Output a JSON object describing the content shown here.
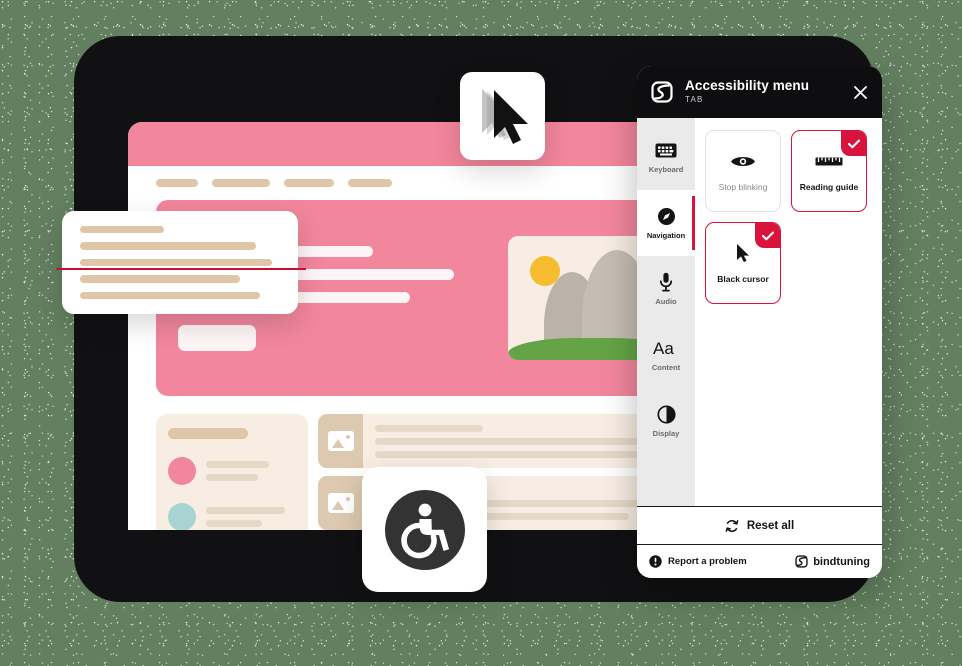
{
  "panel": {
    "title": "Accessibility menu",
    "subtitle": "TAB",
    "logo_icon": "bindtuning-logo-icon",
    "close_icon": "close-icon",
    "accent_color": "#D8143C",
    "rail": [
      {
        "label": "Keyboard",
        "icon": "keyboard-icon",
        "active": false
      },
      {
        "label": "Navigation",
        "icon": "compass-icon",
        "active": true
      },
      {
        "label": "Audio",
        "icon": "microphone-icon",
        "active": false
      },
      {
        "label": "Content",
        "icon": "text-size-icon",
        "active": false
      },
      {
        "label": "Display",
        "icon": "contrast-icon",
        "active": false
      }
    ],
    "features": [
      {
        "label": "Stop blinking",
        "icon": "eye-icon",
        "enabled": false
      },
      {
        "label": "Reading guide",
        "icon": "ruler-icon",
        "enabled": true
      },
      {
        "label": "Black cursor",
        "icon": "cursor-icon",
        "enabled": true
      }
    ],
    "reset_label": "Reset all",
    "reset_icon": "refresh-icon",
    "report_label": "Report a problem",
    "report_icon": "info-icon",
    "brand_label": "bindtuning",
    "brand_icon": "bindtuning-logo-icon"
  },
  "overlays": {
    "cursor_card_icon": "black-cursor-icon",
    "accessibility_card_icon": "wheelchair-accessibility-icon",
    "reading_guide_line_color": "#C8102E"
  },
  "mockup": {
    "topbar_color": "#F2869C",
    "nav_links": [
      42,
      58,
      50,
      44
    ],
    "hero": {
      "bar_widths": [
        "62%",
        "88%",
        "74%"
      ],
      "image_icon": "mountain-landscape-illustration"
    },
    "side_cards": 2,
    "bottom": {
      "left_card": {
        "people": [
          {
            "avatar_color": "#F2869C"
          },
          {
            "avatar_color": "#A8D3D3"
          }
        ]
      },
      "rows": 3,
      "right_card_dots": 4
    }
  }
}
